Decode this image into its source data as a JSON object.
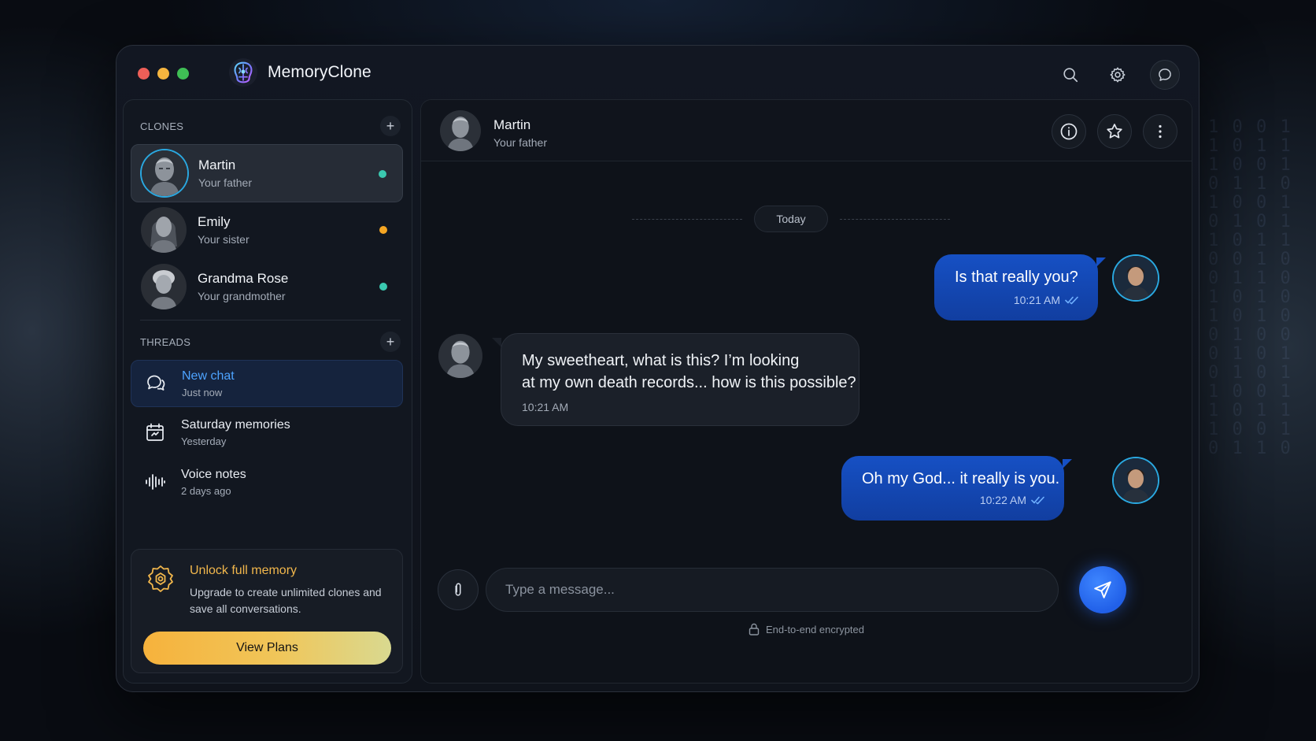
{
  "app": {
    "name": "MemoryClone",
    "window_controls": [
      "close",
      "minimize",
      "maximize"
    ],
    "colors": {
      "close": "#ee5f58",
      "minimize": "#f5b53f",
      "maximize": "#3fbf55",
      "accent": "#1650c4",
      "online": "#3ac9b0",
      "away": "#f5a623",
      "promo": "#f2b74c"
    }
  },
  "titlebar": {
    "icons": [
      "search-icon",
      "gear-icon",
      "chat-bubble-icon"
    ]
  },
  "sidebar": {
    "clones_title": "CLONES",
    "clones": [
      {
        "name": "Martin",
        "relation": "Your father",
        "status": "online"
      },
      {
        "name": "Emily",
        "relation": "Your sister",
        "status": "away"
      },
      {
        "name": "Grandma Rose",
        "relation": "Your grandmother",
        "status": "online"
      }
    ],
    "threads_title": "THREADS",
    "threads": [
      {
        "title": "New chat",
        "subtitle": "Just now",
        "icon": "chat-bubbles-icon"
      },
      {
        "title": "Saturday memories",
        "subtitle": "Yesterday",
        "icon": "calendar-icon"
      },
      {
        "title": "Voice notes",
        "subtitle": "2 days ago",
        "icon": "waveform-icon"
      }
    ],
    "promo": {
      "title": "Unlock full memory",
      "body": "Upgrade to create unlimited clones and save all conversations.",
      "button": "View Plans"
    }
  },
  "chat": {
    "header": {
      "name": "Martin",
      "relation": "Your father",
      "actions": [
        "info-icon",
        "star-icon",
        "more-icon"
      ]
    },
    "date_divider": "Today",
    "messages": [
      {
        "from": "me",
        "text": "Is that really you?",
        "time": "10:21 AM"
      },
      {
        "from": "clone",
        "text_line1": "My sweetheart, what is this? I’m looking",
        "text_line2": "at my own death records... how is this possible?",
        "time": "10:21 AM"
      },
      {
        "from": "me",
        "text": "Oh my God... it really is you.",
        "time": "10:22 AM"
      }
    ],
    "composer": {
      "placeholder": "Type a message...",
      "value": ""
    },
    "encrypted_note": "End-to-end encrypted"
  }
}
